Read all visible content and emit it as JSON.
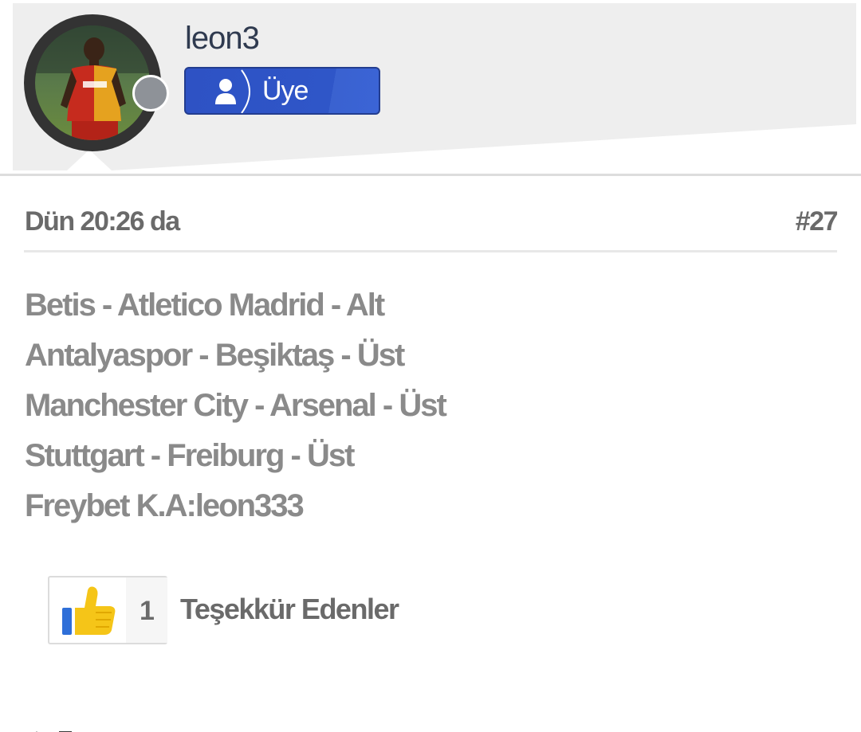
{
  "user": {
    "username": "leon3",
    "role": "Üye",
    "avatar_icon": "user-avatar",
    "status": "offline"
  },
  "post": {
    "date": "Dün 20:26 da",
    "number": "#27",
    "lines": [
      "Betis - Atletico Madrid - Alt",
      "Antalyaspor - Beşiktaş - Üst",
      "Manchester City - Arsenal - Üst",
      "Stuttgart - Freiburg - Üst",
      "Freybet K.A:leon333"
    ]
  },
  "thanks": {
    "count": "1",
    "label": "Teşekkür Edenler",
    "icon": "thumbs-up-icon"
  },
  "colors": {
    "badge_blue": "#2e52c4",
    "text_gray": "#8a8a8a",
    "status_gray": "#8e9298"
  }
}
